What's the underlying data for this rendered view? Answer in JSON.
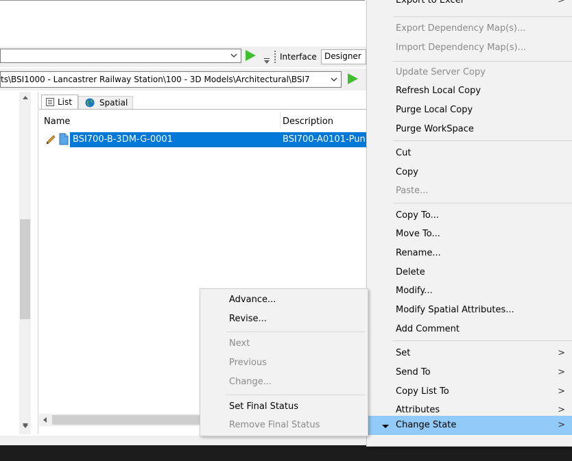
{
  "toolbar": {
    "combo_value": "",
    "interface_label": "Interface",
    "designer_label": "Designer",
    "path_value": "ts\\BSI1000 - Lancastrer Railway Station\\100 - 3D Models\\Architectural\\BSI7"
  },
  "tabs": [
    {
      "label": "List"
    },
    {
      "label": "Spatial"
    }
  ],
  "list": {
    "headers": {
      "name": "Name",
      "description": "Description"
    },
    "rows": [
      {
        "name": "BSI700-B-3DM-G-0001",
        "description": "BSI700-A0101-Pun"
      }
    ]
  },
  "context_menu": {
    "items": [
      {
        "label": "Export to Excel",
        "submenu": true
      },
      {
        "label": "Export Dependency Map(s)...",
        "disabled": true
      },
      {
        "label": "Import Dependency Map(s)...",
        "disabled": true
      },
      {
        "label": "Update Server Copy",
        "disabled": true
      },
      {
        "label": "Refresh Local Copy"
      },
      {
        "label": "Purge Local Copy"
      },
      {
        "label": "Purge WorkSpace"
      },
      {
        "label": "Cut"
      },
      {
        "label": "Copy"
      },
      {
        "label": "Paste...",
        "disabled": true
      },
      {
        "label": "Copy To..."
      },
      {
        "label": "Move To..."
      },
      {
        "label": "Rename..."
      },
      {
        "label": "Delete"
      },
      {
        "label": "Modify..."
      },
      {
        "label": "Modify Spatial Attributes..."
      },
      {
        "label": "Add Comment"
      },
      {
        "label": "Set",
        "submenu": true
      },
      {
        "label": "Send To",
        "submenu": true
      },
      {
        "label": "Copy List To",
        "submenu": true
      },
      {
        "label": "Attributes",
        "submenu": true
      },
      {
        "label": "Change State",
        "submenu": true,
        "highlighted": true
      }
    ],
    "submenu_arrow": ">"
  },
  "state_menu": {
    "items": [
      {
        "label": "Advance..."
      },
      {
        "label": "Revise..."
      },
      {
        "label": "Next",
        "disabled": true
      },
      {
        "label": "Previous",
        "disabled": true
      },
      {
        "label": "Change...",
        "disabled": true
      },
      {
        "label": "Set Final Status"
      },
      {
        "label": "Remove Final Status",
        "disabled": true
      }
    ]
  },
  "colors": {
    "selection": "#0078d7",
    "menu_highlight": "#91c9f7",
    "play_green": "#3fbf2e"
  }
}
